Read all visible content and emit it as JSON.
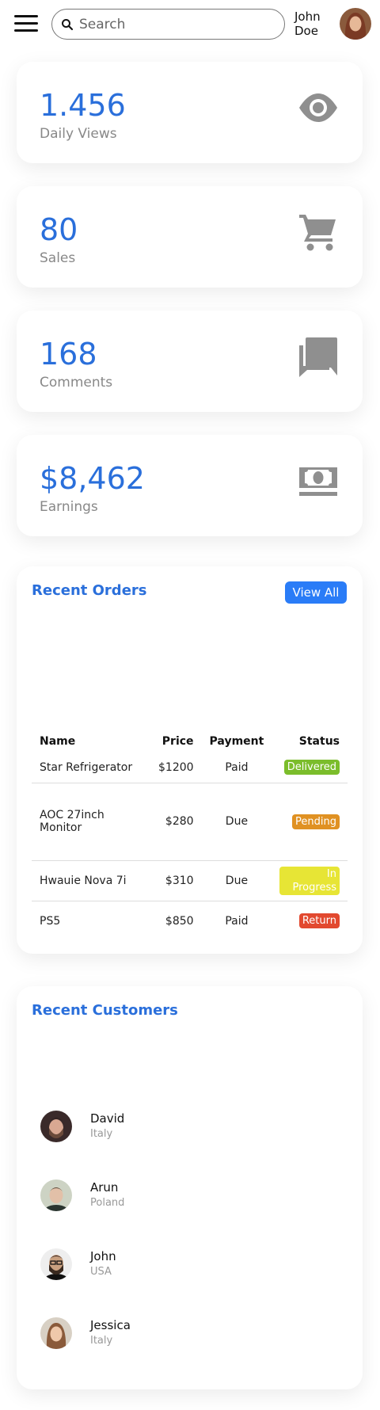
{
  "header": {
    "search": {
      "placeholder": "Search",
      "value": ""
    },
    "user": {
      "name": "John Doe"
    }
  },
  "stats": [
    {
      "value": "1.456",
      "label": "Daily Views",
      "icon": "eye-icon"
    },
    {
      "value": "80",
      "label": "Sales",
      "icon": "cart-icon"
    },
    {
      "value": "168",
      "label": "Comments",
      "icon": "comments-icon"
    },
    {
      "value": "$8,462",
      "label": "Earnings",
      "icon": "cash-icon"
    }
  ],
  "recent_orders": {
    "title": "Recent Orders",
    "view_all_label": "View All",
    "columns": [
      "Name",
      "Price",
      "Payment",
      "Status"
    ],
    "rows": [
      {
        "name": "Star Refrigerator",
        "price": "$1200",
        "payment": "Paid",
        "status": "Delivered",
        "status_color": "#7bbd2b"
      },
      {
        "name": "AOC 27inch Monitor",
        "price": "$280",
        "payment": "Due",
        "status": "Pending",
        "status_color": "#e09122"
      },
      {
        "name": "Hwauie Nova 7i",
        "price": "$310",
        "payment": "Due",
        "status": "In Progress",
        "status_color": "#e7e535"
      },
      {
        "name": "PS5",
        "price": "$850",
        "payment": "Paid",
        "status": "Return",
        "status_color": "#e2492f"
      }
    ]
  },
  "recent_customers": {
    "title": "Recent Customers",
    "items": [
      {
        "name": "David",
        "country": "Italy"
      },
      {
        "name": "Arun",
        "country": "Poland"
      },
      {
        "name": "John",
        "country": "USA"
      },
      {
        "name": "Jessica",
        "country": "Italy"
      }
    ]
  },
  "colors": {
    "accent": "#2a6fdb",
    "button": "#2a7cf7",
    "icon_gray": "#8f8f8f"
  }
}
